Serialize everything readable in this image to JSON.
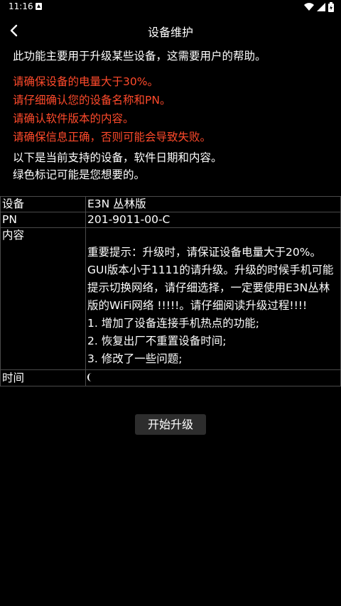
{
  "status_bar": {
    "time": "11:16"
  },
  "app_bar": {
    "title": "设备维护"
  },
  "intro": "此功能主要用于升级某些设备，这需要用户的帮助。",
  "warnings": [
    "请确保设备的电量大于30%。",
    "请仔细确认您的设备名称和PN。",
    "请确认软件版本的内容。",
    "请确保信息正确，否则可能会导致失败。"
  ],
  "support_text": [
    "以下是当前支持的设备，软件日期和内容。",
    "绿色标记可能是您想要的。"
  ],
  "table": {
    "device_label": "设备",
    "device_value": "E3N 丛林版",
    "pn_label": "PN",
    "pn_value": "201-9011-00-C",
    "content_label": "内容",
    "content_lines": [
      "重要提示：升级时，请保证设备电量大于20%。GUI版本小于1111的请升级。升级的时候手机可能提示切换网络，请仔细选择，一定要使用E3N丛林版的WiFi网络 !!!!!。请仔细阅读升级过程!!!!",
      "1. 增加了设备连接手机热点的功能;",
      "2. 恢复出厂不重置设备时间;",
      "3. 修改了一些问题;"
    ],
    "time_label": "时间"
  },
  "start_button_label": "开始升级",
  "colors": {
    "background": "#000000",
    "warning_text": "#ff4a2b",
    "button_bg": "#2d2d2d",
    "table_border": "#4a4a4a"
  },
  "icons": [
    "notification-icon",
    "wifi-icon",
    "signal-icon",
    "battery-icon",
    "back-arrow-icon"
  ]
}
